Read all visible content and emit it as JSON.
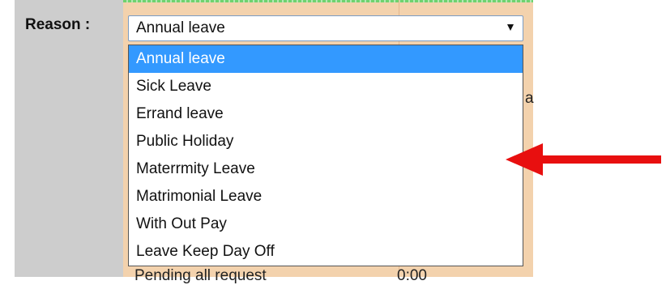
{
  "form": {
    "reason_label": "Reason :",
    "reason_select": {
      "selected_value": "Annual leave",
      "options": [
        {
          "label": "Annual leave",
          "selected": true
        },
        {
          "label": "Sick Leave",
          "selected": false
        },
        {
          "label": "Errand leave",
          "selected": false
        },
        {
          "label": "Public Holiday",
          "selected": false
        },
        {
          "label": "Materrmity Leave",
          "selected": false
        },
        {
          "label": "Matrimonial Leave",
          "selected": false
        },
        {
          "label": "With Out Pay",
          "selected": false
        },
        {
          "label": "Leave Keep Day Off",
          "selected": false
        }
      ]
    }
  },
  "background": {
    "partial_row_label": "Pending all request",
    "partial_row_time": "0:00",
    "partial_glyph": "a"
  },
  "annotation": {
    "arrow_color": "#e80f0f",
    "arrow_direction": "left"
  },
  "colors": {
    "highlight": "#3399ff",
    "panel": "#cdcdcd",
    "strip": "#f3d2ad"
  }
}
